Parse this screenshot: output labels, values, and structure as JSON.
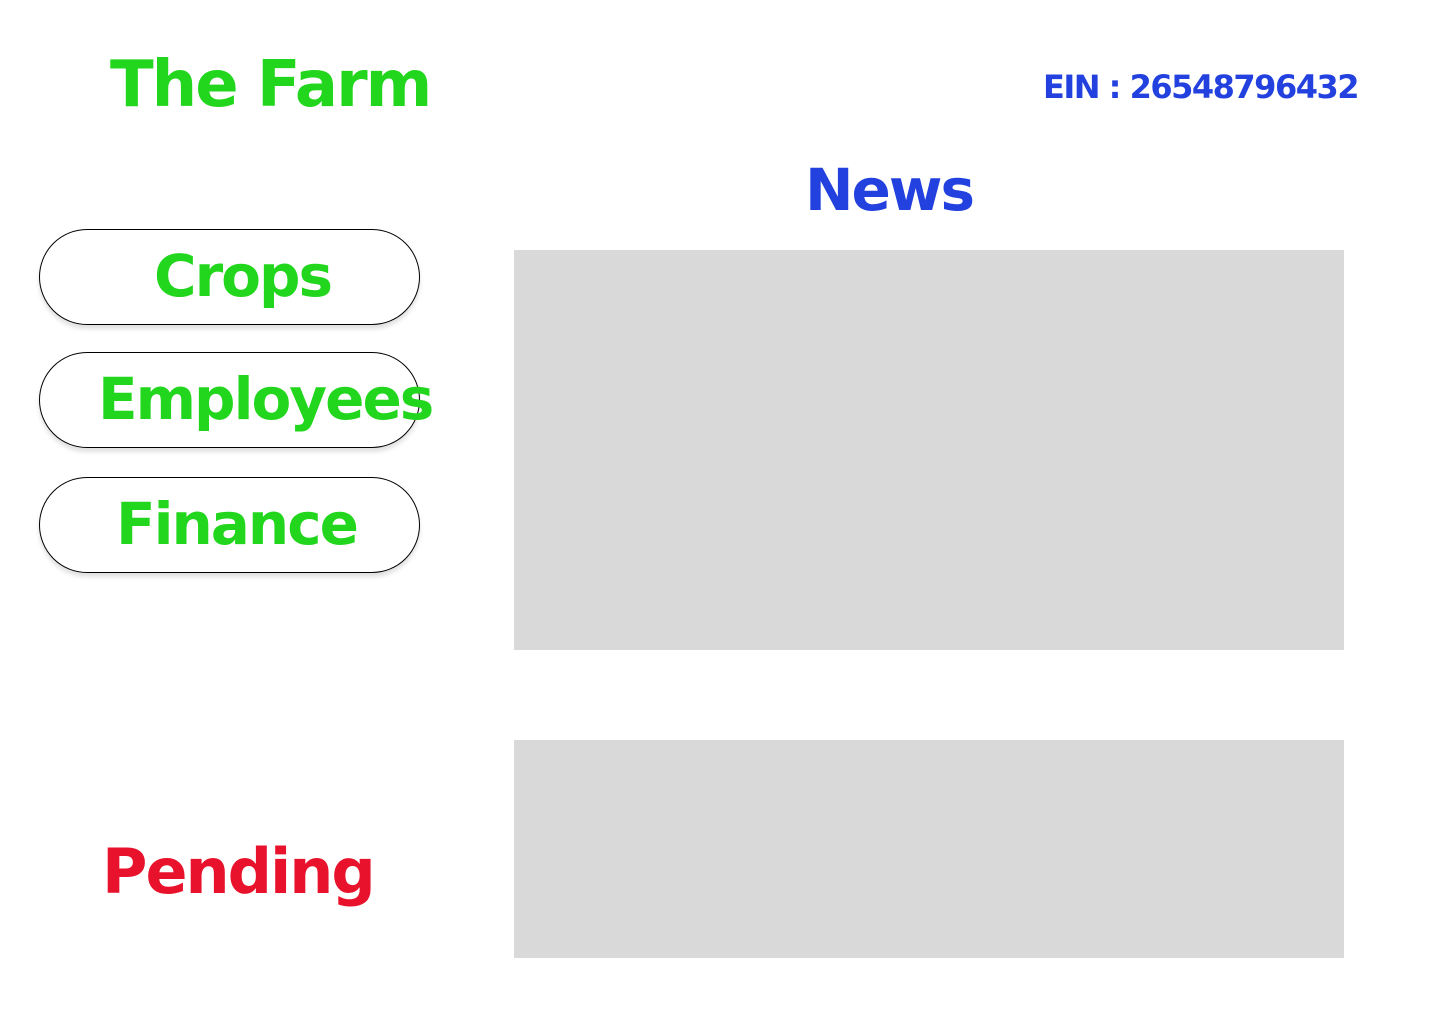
{
  "header": {
    "brand": "The Farm",
    "ein": "EIN : 26548796432"
  },
  "nav": {
    "buttons": [
      {
        "label": "Crops"
      },
      {
        "label": "Employees"
      },
      {
        "label": "Finance"
      }
    ]
  },
  "news": {
    "title": "News"
  },
  "pending": {
    "label": "Pending"
  },
  "colors": {
    "brand_green": "#22d61e",
    "heading_blue": "#2241de",
    "pending_red": "#e8122c",
    "panel_gray": "#d9d9d9"
  }
}
